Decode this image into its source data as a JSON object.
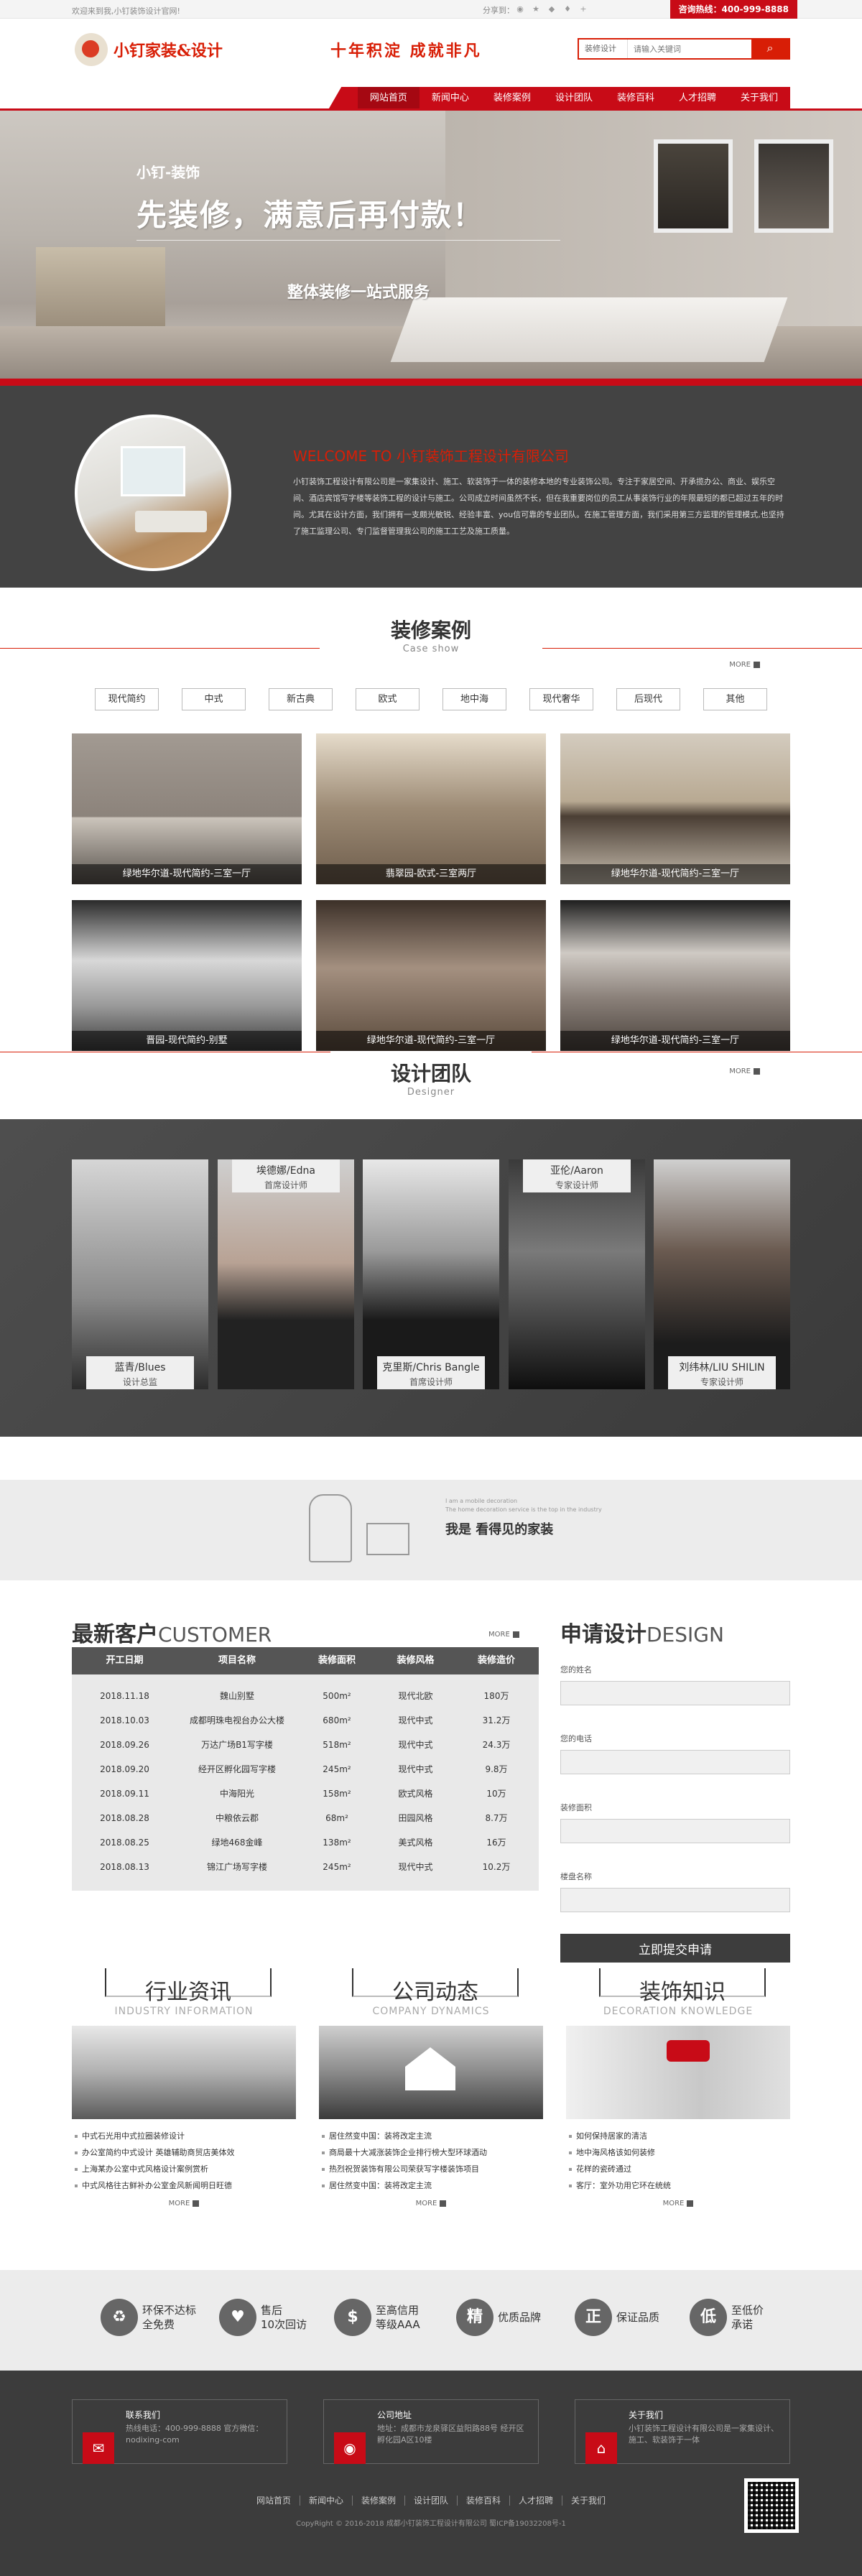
{
  "topbar": {
    "welcome": "欢迎来到我,小钉装饰设计官网!",
    "share": "分享到：",
    "hotline": "咨询热线：400-999-8888"
  },
  "header": {
    "logo_text": "小钉家装&设计",
    "slogan": "十年积淀 成就非凡",
    "search_select": "装修设计",
    "search_placeholder": "请输入关键词"
  },
  "nav": [
    "网站首页",
    "新闻中心",
    "装修案例",
    "设计团队",
    "装修百科",
    "人才招聘",
    "关于我们"
  ],
  "hero": {
    "subtitle": "小钉-装饰",
    "title": "先装修，满意后再付款！",
    "desc": "整体装修一站式服务"
  },
  "about": {
    "title": "WELCOME TO 小钉装饰工程设计有限公司",
    "text": "小钉装饰工程设计有限公司是一家集设计、施工、软装饰于一体的装修本地的专业装饰公司。专注于家居空间、开承揽办公、商业、娱乐空间、酒店宾馆写字楼等装饰工程的设计与施工。公司成立时间虽然不长，但在我重要岗位的员工从事装饰行业的年限最短的都已超过五年的时间。尤其在设计方面，我们拥有一支颇光敏锐、经验丰富、you信可靠的专业团队。在施工管理方面，我们采用第三方监理的管理模式,也坚持了施工监理公司、专门监督管理我公司的施工工艺及施工质量。"
  },
  "cases": {
    "title": "装修案例",
    "en": "Case show",
    "more": "MORE",
    "tags": [
      "现代简约",
      "中式",
      "新古典",
      "欧式",
      "地中海",
      "现代奢华",
      "后现代",
      "其他"
    ],
    "items": [
      {
        "caption": "绿地华尔道-现代简约-三室一厅"
      },
      {
        "caption": "翡翠园-欧式-三室两厅"
      },
      {
        "caption": "绿地华尔道-现代简约-三室一厅"
      },
      {
        "caption": "晋园-现代简约-别墅"
      },
      {
        "caption": "绿地华尔道-现代简约-三室一厅"
      },
      {
        "caption": "绿地华尔道-现代简约-三室一厅"
      }
    ]
  },
  "team": {
    "title": "设计团队",
    "en": "Designer",
    "more": "MORE",
    "members": [
      {
        "name": "蓝青/Blues",
        "role": "设计总监"
      },
      {
        "name": "埃德娜/Edna",
        "role": "首席设计师"
      },
      {
        "name": "克里斯/Chris Bangle",
        "role": "首席设计师"
      },
      {
        "name": "亚伦/Aaron",
        "role": "专家设计师"
      },
      {
        "name": "刘纬林/LIU SHILIN",
        "role": "专家设计师"
      }
    ]
  },
  "banner": {
    "small1": "I am a mobile decoration",
    "small2": "The home decoration service is the top in the industry",
    "main": "我是 看得见的家装"
  },
  "customer": {
    "title": "最新客户",
    "title_en": "CUSTOMER",
    "more": "MORE",
    "columns": [
      "开工日期",
      "项目名称",
      "装修面积",
      "装修风格",
      "装修造价"
    ],
    "rows": [
      [
        "2018.11.18",
        "魏山别墅",
        "500m²",
        "现代北欧",
        "180万"
      ],
      [
        "2018.10.03",
        "成都明珠电视台办公大楼",
        "680m²",
        "现代中式",
        "31.2万"
      ],
      [
        "2018.09.26",
        "万达广场B1写字楼",
        "518m²",
        "现代中式",
        "24.3万"
      ],
      [
        "2018.09.20",
        "经开区孵化园写字楼",
        "245m²",
        "现代中式",
        "9.8万"
      ],
      [
        "2018.09.11",
        "中海阳光",
        "158m²",
        "欧式风格",
        "10万"
      ],
      [
        "2018.08.28",
        "中粮依云郡",
        "68m²",
        "田园风格",
        "8.7万"
      ],
      [
        "2018.08.25",
        "绿地468金峰",
        "138m²",
        "美式风格",
        "16万"
      ],
      [
        "2018.08.13",
        "锦江广场写字楼",
        "245m²",
        "现代中式",
        "10.2万"
      ]
    ]
  },
  "design_form": {
    "title": "申请设计",
    "title_en": "DESIGN",
    "labels": [
      "您的姓名",
      "您的电话",
      "装修面积",
      "楼盘名称"
    ],
    "submit": "立即提交申请"
  },
  "news": [
    {
      "title": "行业资讯",
      "en": "INDUSTRY INFORMATION",
      "more": "MORE",
      "items": [
        "中式石光用中式拉圈装修设计",
        "办公室简约中式设计 英雄辅助商贸店美体效",
        "上海某办公室中式风格设计案例赏析",
        "中式风格往古鲜补办公室金风新闻明日旺德"
      ]
    },
    {
      "title": "公司动态",
      "en": "COMPANY DYNAMICS",
      "more": "MORE",
      "items": [
        "居住然变中国：装将改定主流",
        "商局最十大减涨装饰企业排行榜大型环球酒动",
        "热烈祝贺装饰有限公司荣获写字楼装饰项目",
        "居住然变中国：装将改定主流"
      ]
    },
    {
      "title": "装饰知识",
      "en": "DECORATION KNOWLEDGE",
      "more": "MORE",
      "items": [
        "如何保持居家的清洁",
        "地中海风格该如何装修",
        "花样的瓷砖通过",
        "客厅：室外功用它环在统统"
      ]
    }
  ],
  "service": [
    {
      "t1": "环保不达标",
      "t2": "全免费"
    },
    {
      "t1": "售后",
      "t2": "10次回访"
    },
    {
      "t1": "至高信用",
      "t2": "等级AAA"
    },
    {
      "t1": "优质品牌",
      "t2": ""
    },
    {
      "t1": "保证品质",
      "t2": ""
    },
    {
      "t1": "至低价",
      "t2": "承诺"
    }
  ],
  "footer": {
    "boxes": [
      {
        "t": "联系我们",
        "d": "热线电话：400-999-8888 官方微信：nodixing-com"
      },
      {
        "t": "公司地址",
        "d": "地址：成都市龙泉驿区益阳路88号 经开区孵化园A区10楼"
      },
      {
        "t": "关于我们",
        "d": "小钉装饰工程设计有限公司是一家集设计、施工、软装饰于一体"
      }
    ],
    "nav": [
      "网站首页",
      "新闻中心",
      "装修案例",
      "设计团队",
      "装修百科",
      "人才招聘",
      "关于我们"
    ],
    "copy": "CopyRight © 2016-2018 成都小钉装饰工程设计有限公司 蜀ICP备19032208号-1"
  }
}
